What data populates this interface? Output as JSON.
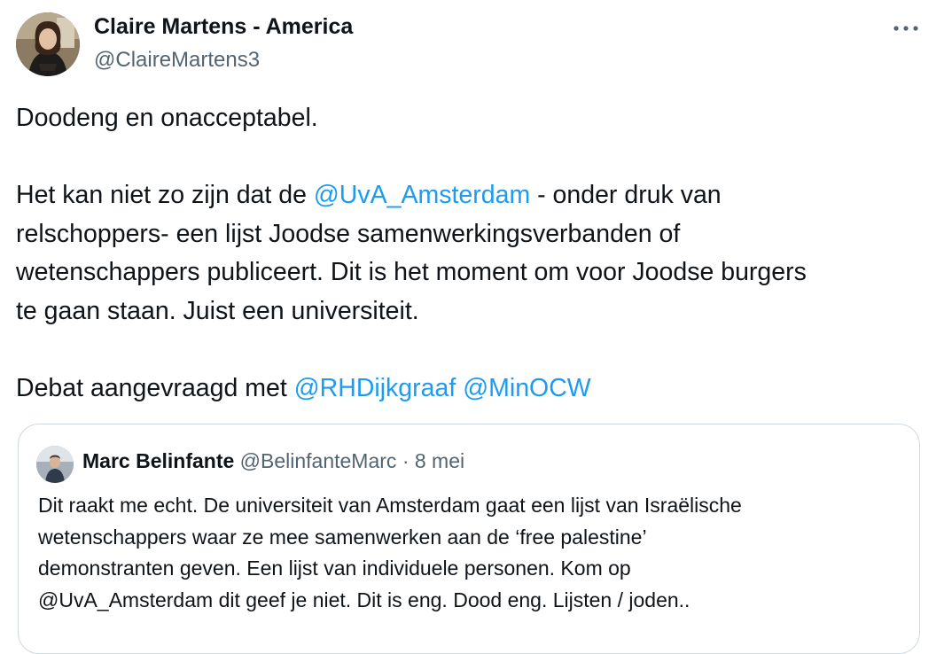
{
  "author": {
    "name": "Claire Martens - America",
    "handle": "@ClaireMartens3"
  },
  "more_icon": "more-horizontal-icon",
  "tweet": {
    "line1": "Doodeng en onacceptabel.",
    "line2_pre": "Het kan niet zo zijn dat de ",
    "line2_mention": "@UvA_Amsterdam",
    "line2_post": " - onder druk van",
    "line3": "relschoppers- een lijst Joodse samenwerkingsverbanden of",
    "line4": "wetenschappers publiceert. Dit is het moment om voor Joodse burgers",
    "line5": "te gaan staan. Juist een universiteit.",
    "line6_pre": "Debat aangevraagd met ",
    "line6_mention1": "@RHDijkgraaf",
    "line6_mention2": "@MinOCW"
  },
  "quote": {
    "name": "Marc Belinfante",
    "handle": "@BelinfanteMarc",
    "separator": "·",
    "date": "8 mei",
    "lines": [
      "Dit raakt me echt. De universiteit van Amsterdam gaat een lijst van Israëlische",
      "wetenschappers waar ze mee samenwerken aan de ‘free palestine’",
      "demonstranten geven. Een lijst van individuele personen. Kom op",
      "@UvA_Amsterdam dit geef je niet. Dit is eng. Dood eng. Lijsten / joden.."
    ]
  },
  "colors": {
    "text": "#0f1419",
    "secondary": "#536471",
    "link": "#1d9bf0",
    "border": "#cfd9de"
  }
}
